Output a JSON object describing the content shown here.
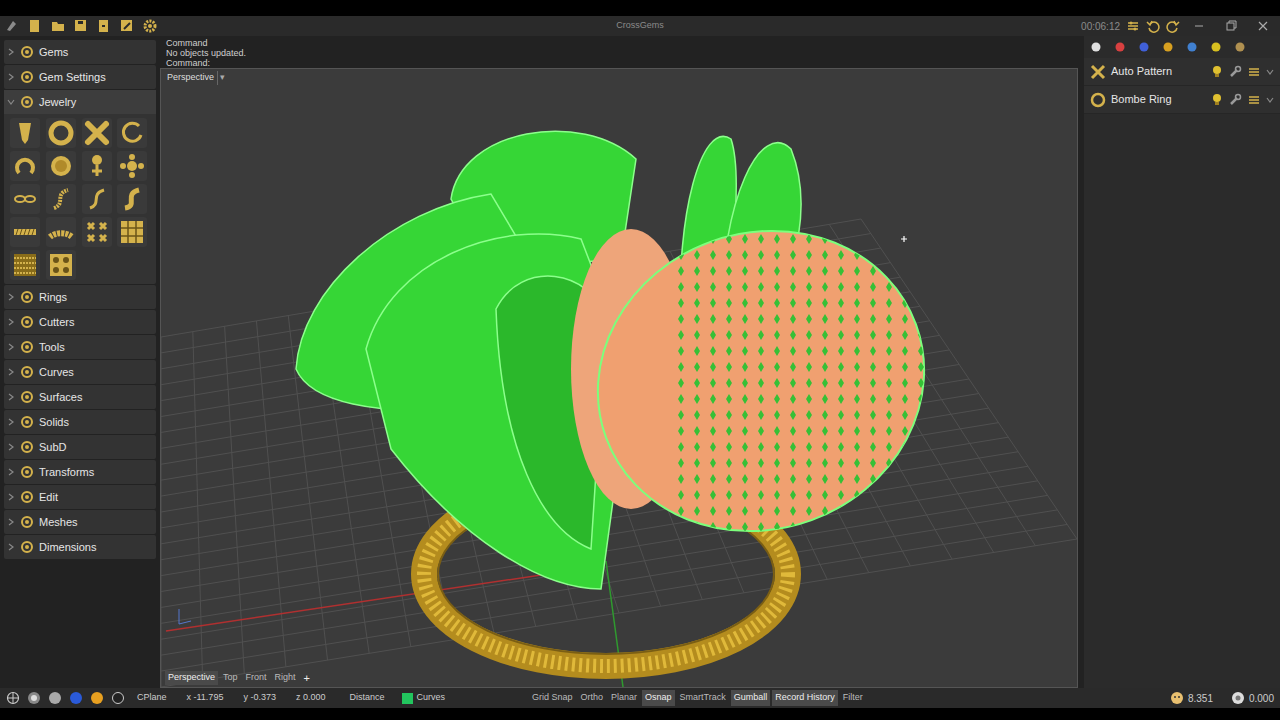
{
  "window": {
    "title": "CrossGems",
    "timer": "00:06:12"
  },
  "command": {
    "lines": [
      "Command",
      "No objects updated.",
      "Command:"
    ]
  },
  "left_panel": {
    "sections": [
      {
        "label": "Gems",
        "expanded": false
      },
      {
        "label": "Gem Settings",
        "expanded": false
      },
      {
        "label": "Jewelry",
        "expanded": true
      },
      {
        "label": "Rings",
        "expanded": false
      },
      {
        "label": "Cutters",
        "expanded": false
      },
      {
        "label": "Tools",
        "expanded": false
      },
      {
        "label": "Curves",
        "expanded": false
      },
      {
        "label": "Surfaces",
        "expanded": false
      },
      {
        "label": "Solids",
        "expanded": false
      },
      {
        "label": "SubD",
        "expanded": false
      },
      {
        "label": "Transforms",
        "expanded": false
      },
      {
        "label": "Edit",
        "expanded": false
      },
      {
        "label": "Meshes",
        "expanded": false
      },
      {
        "label": "Dimensions",
        "expanded": false
      }
    ]
  },
  "viewport": {
    "label": "Perspective",
    "menu_glyph": "▾",
    "tabs": [
      {
        "label": "Perspective",
        "selected": true
      },
      {
        "label": "Top",
        "selected": false
      },
      {
        "label": "Front",
        "selected": false
      },
      {
        "label": "Right",
        "selected": false
      }
    ],
    "add_tab": "+"
  },
  "right_panel": {
    "items": [
      {
        "label": "Auto Pattern"
      },
      {
        "label": "Bombe Ring"
      }
    ]
  },
  "status_bar": {
    "cplane": "CPlane",
    "x": "x -11.795",
    "y": "y -0.373",
    "z": "z 0.000",
    "distance": "Distance",
    "layer": {
      "label": "Curves",
      "color": "#22c55e"
    },
    "toggles": [
      {
        "label": "Grid Snap",
        "on": false
      },
      {
        "label": "Ortho",
        "on": false
      },
      {
        "label": "Planar",
        "on": false
      },
      {
        "label": "Osnap",
        "on": true
      },
      {
        "label": "SmartTrack",
        "on": false
      },
      {
        "label": "Gumball",
        "on": true
      },
      {
        "label": "Record History",
        "on": true
      },
      {
        "label": "Filter",
        "on": false
      }
    ],
    "readings": [
      "8.351",
      "0.000"
    ]
  }
}
